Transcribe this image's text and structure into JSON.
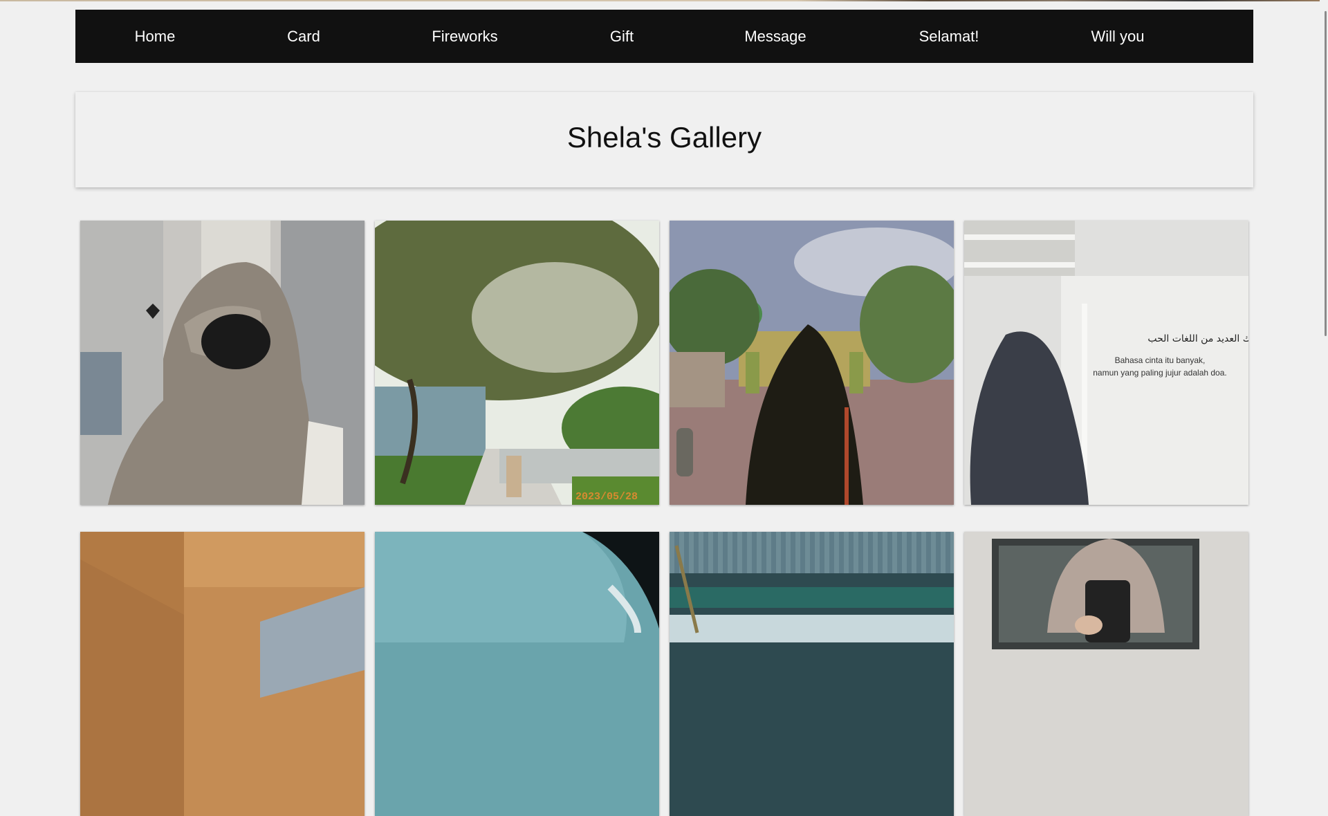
{
  "nav": {
    "items": [
      {
        "label": "Home"
      },
      {
        "label": "Card"
      },
      {
        "label": "Fireworks"
      },
      {
        "label": "Gift"
      },
      {
        "label": "Message"
      },
      {
        "label": "Selamat!"
      },
      {
        "label": "Will you"
      }
    ]
  },
  "gallery": {
    "title": "Shela's Gallery",
    "photos": [
      {
        "stamp": "2023/05/28"
      },
      {
        "arabic": "هنالك العديد من اللغات الحب",
        "line1": "Bahasa cinta itu banyak,",
        "line2": "namun yang paling jujur adalah doa."
      }
    ]
  },
  "colors": {
    "nav_bg": "#111111",
    "nav_text": "#ffffff",
    "page_bg": "#f0f0f0"
  }
}
